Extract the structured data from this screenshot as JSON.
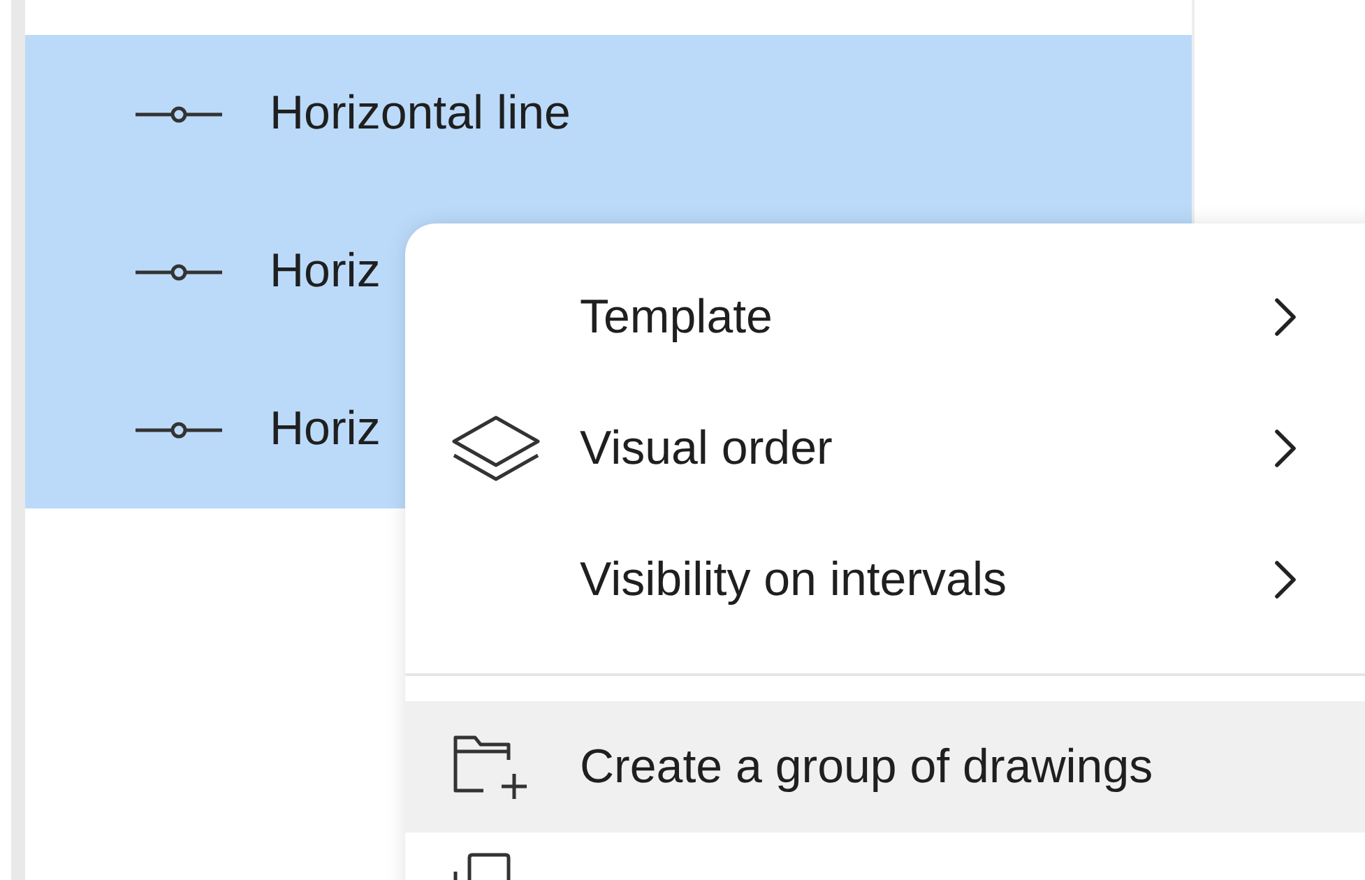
{
  "drawings_list": {
    "rows": [
      {
        "label": "Horizontal line",
        "selected": true
      },
      {
        "label": "Horiz",
        "selected": true
      },
      {
        "label": "Horiz",
        "selected": true
      }
    ]
  },
  "context_menu": {
    "groups": [
      [
        {
          "label": "Template",
          "kind": "submenu",
          "highlighted": false
        },
        {
          "label": "Visual order",
          "kind": "submenu",
          "highlighted": false
        },
        {
          "label": "Visibility on intervals",
          "kind": "submenu",
          "highlighted": false
        }
      ],
      [
        {
          "label": "Create a group of drawings",
          "kind": "action",
          "highlighted": true
        }
      ]
    ]
  }
}
